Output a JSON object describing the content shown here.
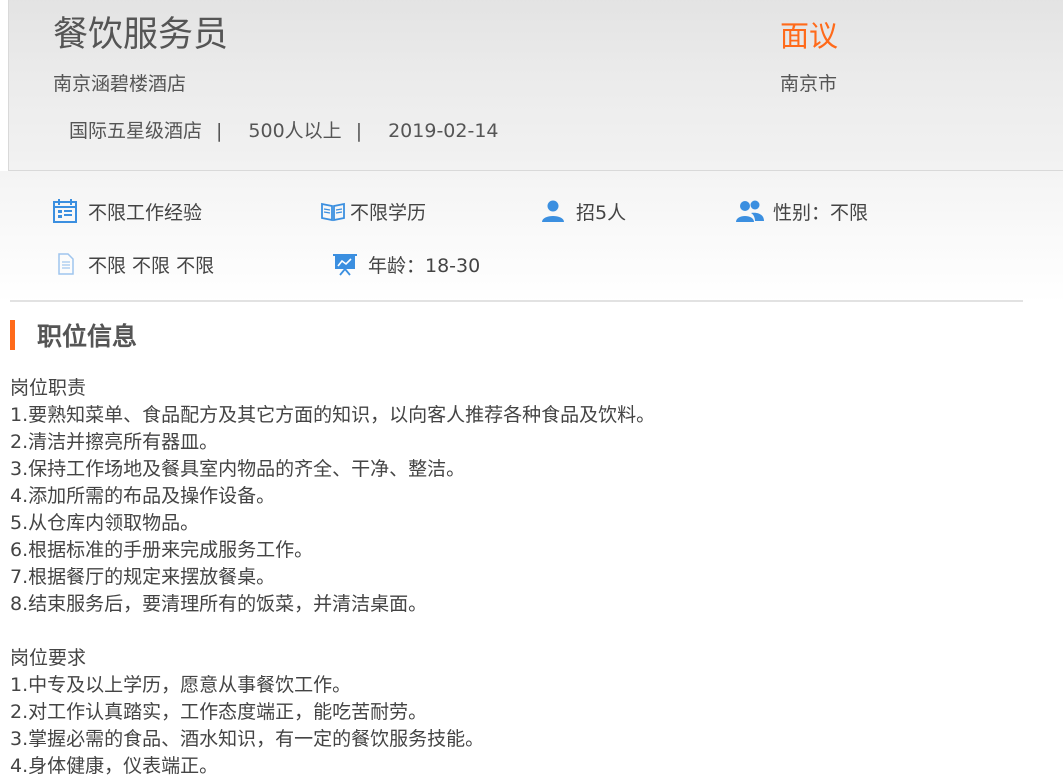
{
  "job": {
    "title": "餐饮服务员",
    "salary": "面议",
    "company": "南京涵碧楼酒店",
    "city": "南京市",
    "company_type": "国际五星级酒店",
    "company_size": "500人以上",
    "date": "2019-02-14",
    "separator": "|"
  },
  "info": {
    "experience": "不限工作经验",
    "education": "不限学历",
    "headcount": "招5人",
    "gender": "性别：不限",
    "other": "不限 不限 不限",
    "age": "年龄：18-30"
  },
  "section": {
    "title": "职位信息"
  },
  "description": {
    "duties_heading": "岗位职责",
    "duties": [
      "1.要熟知菜单、食品配方及其它方面的知识，以向客人推荐各种食品及饮料。",
      "2.清洁并擦亮所有器皿。",
      "3.保持工作场地及餐具室内物品的齐全、干净、整洁。",
      "4.添加所需的布品及操作设备。",
      "5.从仓库内领取物品。",
      "6.根据标准的手册来完成服务工作。",
      "7.根据餐厅的规定来摆放餐桌。",
      "8.结束服务后，要清理所有的饭菜，并清洁桌面。"
    ],
    "requirements_heading": "岗位要求",
    "requirements": [
      "1.中专及以上学历，愿意从事餐饮工作。",
      "2.对工作认真踏实，工作态度端正，能吃苦耐劳。",
      "3.掌握必需的食品、酒水知识，有一定的餐饮服务技能。",
      "4.身体健康，仪表端正。"
    ]
  },
  "colors": {
    "accent": "#ff6a1a",
    "icon_blue": "#3b8fe0"
  }
}
